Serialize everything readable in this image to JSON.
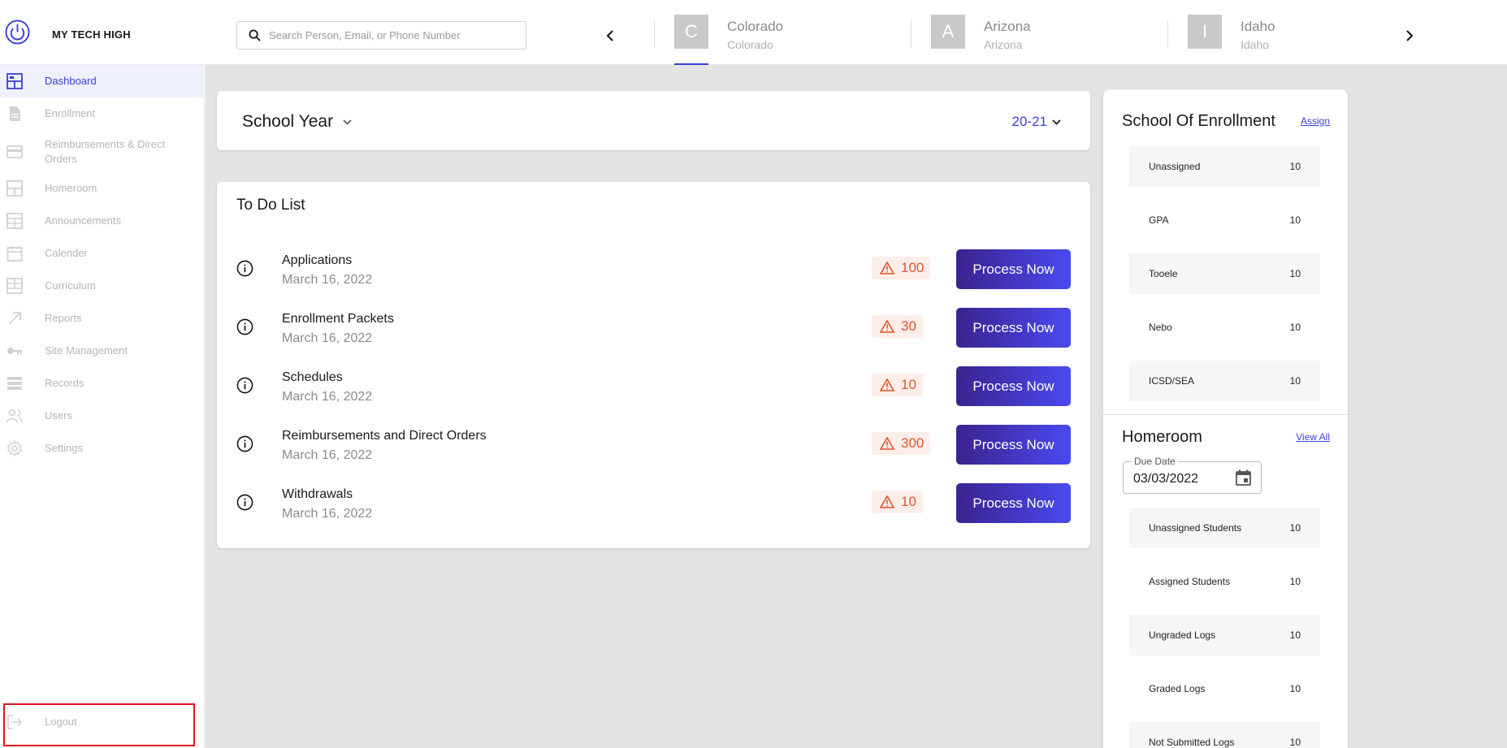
{
  "brand": {
    "name": "MY TECH HIGH"
  },
  "search": {
    "placeholder": "Search Person, Email, or Phone Number"
  },
  "states": [
    {
      "initial": "C",
      "name": "Colorado",
      "sub": "Colorado",
      "active": true
    },
    {
      "initial": "A",
      "name": "Arizona",
      "sub": "Arizona",
      "active": false
    },
    {
      "initial": "I",
      "name": "Idaho",
      "sub": "Idaho",
      "active": false
    }
  ],
  "sidebar": {
    "items": [
      {
        "label": "Dashboard",
        "icon": "dashboard-icon",
        "active": true
      },
      {
        "label": "Enrollment",
        "icon": "document-icon"
      },
      {
        "label": "Reimbursements & Direct Orders",
        "icon": "credit-card-icon"
      },
      {
        "label": "Homeroom",
        "icon": "homeroom-icon"
      },
      {
        "label": "Announcements",
        "icon": "announcements-icon"
      },
      {
        "label": "Calender",
        "icon": "calendar-icon"
      },
      {
        "label": "Curriculum",
        "icon": "curriculum-icon"
      },
      {
        "label": "Reports",
        "icon": "arrow-up-right-icon"
      },
      {
        "label": "Site Management",
        "icon": "key-icon"
      },
      {
        "label": "Records",
        "icon": "list-icon"
      },
      {
        "label": "Users",
        "icon": "users-icon"
      },
      {
        "label": "Settings",
        "icon": "gear-icon"
      }
    ],
    "logout": "Logout"
  },
  "school_year": {
    "label": "School Year",
    "value": "20-21"
  },
  "todo": {
    "title": "To Do List",
    "button_label": "Process Now",
    "rows": [
      {
        "name": "Applications",
        "date": "March 16, 2022",
        "count": "100"
      },
      {
        "name": "Enrollment Packets",
        "date": "March 16, 2022",
        "count": "30"
      },
      {
        "name": "Schedules",
        "date": "March 16, 2022",
        "count": "10"
      },
      {
        "name": "Reimbursements and Direct Orders",
        "date": "March 16, 2022",
        "count": "300"
      },
      {
        "name": "Withdrawals",
        "date": "March 16, 2022",
        "count": "10"
      }
    ]
  },
  "enrollment": {
    "title": "School Of Enrollment",
    "link": "Assign",
    "rows": [
      {
        "name": "Unassigned",
        "count": "10"
      },
      {
        "name": "GPA",
        "count": "10"
      },
      {
        "name": "Tooele",
        "count": "10"
      },
      {
        "name": "Nebo",
        "count": "10"
      },
      {
        "name": "ICSD/SEA",
        "count": "10"
      }
    ]
  },
  "homeroom": {
    "title": "Homeroom",
    "link": "View All",
    "due_label": "Due Date",
    "due_value": "03/03/2022",
    "rows": [
      {
        "name": "Unassigned Students",
        "count": "10"
      },
      {
        "name": "Assigned Students",
        "count": "10"
      },
      {
        "name": "Ungraded Logs",
        "count": "10"
      },
      {
        "name": "Graded Logs",
        "count": "10"
      },
      {
        "name": "Not Submitted Logs",
        "count": "10"
      }
    ]
  },
  "colors": {
    "accent": "#3b3fd6",
    "badge_text": "#e2542a",
    "badge_bg": "#fdeeea",
    "button_start": "#3a238f",
    "button_end": "#4a4af0"
  }
}
